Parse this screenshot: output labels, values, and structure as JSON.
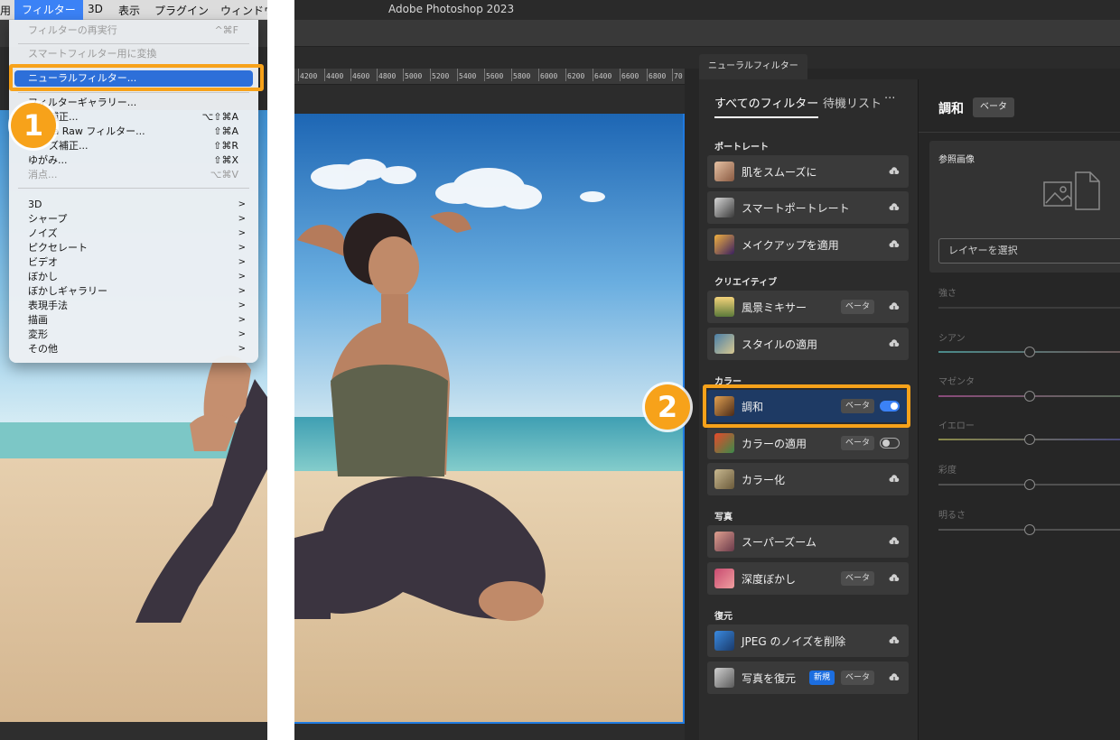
{
  "menubar": {
    "items": [
      "用",
      "フィルター",
      "3D",
      "表示",
      "プラグイン",
      "ウィンドウ"
    ],
    "active_index": 1
  },
  "filter_menu": {
    "item_last_filter": "フィルターの再実行",
    "item_last_filter_shortcut": "^⌘F",
    "item_convert_smart": "スマートフィルター用に変換",
    "item_neural": "ニューラルフィルター...",
    "item_gallery": "フィルターギャラリー...",
    "item_adaptive": "補正...",
    "item_adaptive_shortcut": "⌥⇧⌘A",
    "item_camera_raw": "ra Raw フィルター...",
    "item_camera_raw_shortcut": "⇧⌘A",
    "item_lens": "ズ補正...",
    "item_lens_shortcut": "⇧⌘R",
    "item_liquify": "ゆがみ...",
    "item_liquify_shortcut": "⇧⌘X",
    "item_vanishing": "消点...",
    "item_vanishing_shortcut": "⌥⌘V",
    "submenus": [
      "3D",
      "シャープ",
      "ノイズ",
      "ピクセレート",
      "ビデオ",
      "ぼかし",
      "ぼかしギャラリー",
      "表現手法",
      "描画",
      "変形",
      "その他"
    ]
  },
  "steps": {
    "one": "1",
    "two": "2"
  },
  "ps": {
    "app_title": "Adobe Photoshop 2023",
    "ruler_ticks": [
      "4200",
      "4400",
      "4600",
      "4800",
      "5000",
      "5200",
      "5400",
      "5600",
      "5800",
      "6000",
      "6200",
      "6400",
      "6600",
      "6800",
      "70"
    ]
  },
  "neural": {
    "panel_tab": "ニューラルフィルター",
    "tab_all": "すべてのフィルター",
    "tab_waitlist": "待機リスト",
    "tab_more": "···",
    "categories": {
      "portrait": "ポートレート",
      "creative": "クリエイティブ",
      "color": "カラー",
      "photo": "写真",
      "restore": "復元"
    },
    "filters": {
      "skin": {
        "name": "肌をスムーズに"
      },
      "smart_portrait": {
        "name": "スマートポートレート"
      },
      "makeup": {
        "name": "メイクアップを適用"
      },
      "landscape": {
        "name": "風景ミキサー",
        "badge": "ベータ"
      },
      "style": {
        "name": "スタイルの適用"
      },
      "harmony": {
        "name": "調和",
        "badge": "ベータ"
      },
      "color_transfer": {
        "name": "カラーの適用",
        "badge": "ベータ"
      },
      "colorize": {
        "name": "カラー化"
      },
      "superzoom": {
        "name": "スーパーズーム"
      },
      "depth_blur": {
        "name": "深度ぼかし",
        "badge": "ベータ"
      },
      "jpeg": {
        "name": "JPEG のノイズを削除"
      },
      "photo_restore": {
        "name": "写真を復元",
        "badge_new": "新規",
        "badge": "ベータ"
      }
    },
    "detail": {
      "title": "調和",
      "badge": "ベータ",
      "ref_label": "参照画像",
      "layer_select": "レイヤーを選択",
      "sliders": {
        "strength": {
          "label": "強さ",
          "value": null
        },
        "cyan": {
          "label": "シアン",
          "value": 0.5
        },
        "magenta": {
          "label": "マゼンタ",
          "value": 0.5
        },
        "yellow": {
          "label": "イエロー",
          "value": 0.5
        },
        "saturation": {
          "label": "彩度",
          "value": 0.5
        },
        "brightness": {
          "label": "明るさ",
          "value": 0.5
        }
      }
    }
  },
  "colors": {
    "highlight_orange": "#f7a21a",
    "accent_blue": "#2d6fd9",
    "panel_bg": "#262626"
  }
}
